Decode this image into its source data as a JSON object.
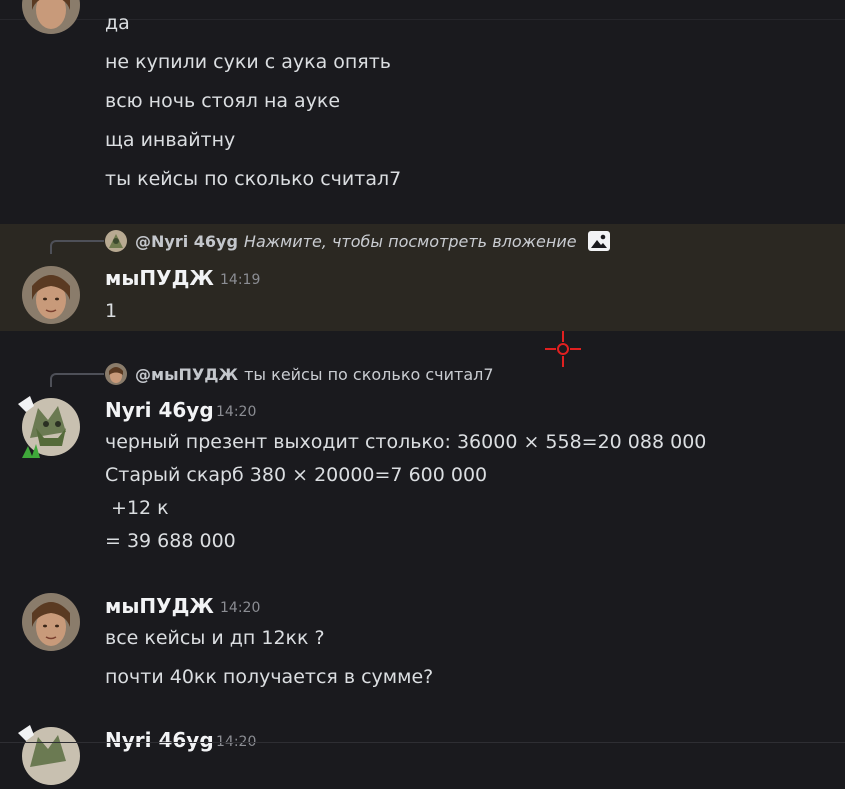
{
  "messages_top": [
    "да",
    "не купили суки с аука опять",
    "всю ночь стоял на ауке",
    "ща инвайтну",
    "ты кейсы по сколько считал7"
  ],
  "msg1": {
    "reply_name": "@Nyri 46yg",
    "reply_text": "Нажмите, чтобы посмотреть вложение",
    "author": "мыПУДЖ",
    "time": "14:19",
    "lines": [
      "1"
    ]
  },
  "msg2": {
    "reply_name": "@мыПУДЖ",
    "reply_text": "ты кейсы по сколько считал7",
    "author": "Nyri 46yg",
    "time": "14:20",
    "lines": [
      "черный презент выходит столько: 36000 × 558=20 088 000",
      "Старый скарб 380 × 20000=7 600 000",
      " +12 к",
      "= 39 688 000"
    ]
  },
  "msg3": {
    "author": "мыПУДЖ",
    "time": "14:20",
    "lines": [
      "все кейсы и дп 12кк ?",
      "почти 40кк получается в сумме?"
    ]
  },
  "msg4": {
    "author": "Nyri 46yg",
    "time": "14:20"
  },
  "colors": {
    "background": "#1a1a1e",
    "highlight": "#2b2822",
    "text": "#dbdee1",
    "muted": "#8b8d93",
    "crosshair": "#e02020"
  },
  "icons": [
    "image-attachment-icon",
    "crosshair-cursor-icon",
    "reply-spine-icon"
  ]
}
